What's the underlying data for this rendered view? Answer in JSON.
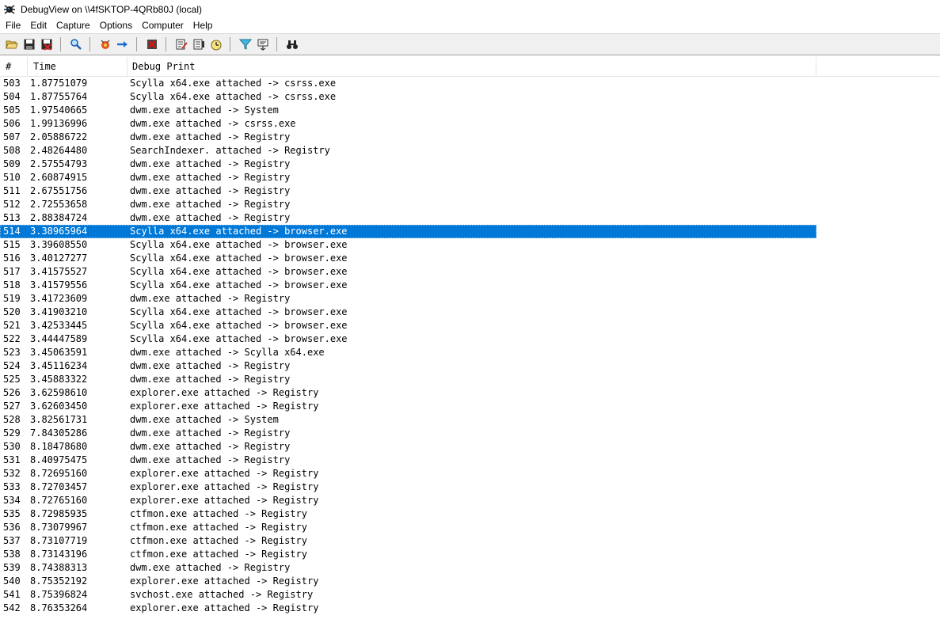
{
  "window": {
    "title": "DebugView on \\\\4fSKTOP-4QRb80J (local)"
  },
  "menu": [
    "File",
    "Edit",
    "Capture",
    "Options",
    "Computer",
    "Help"
  ],
  "toolbar": {
    "groups": [
      [
        "open-icon",
        "save-icon",
        "clear-log-icon"
      ],
      [
        "find-icon"
      ],
      [
        "capture-icon",
        "autoscroll-icon"
      ],
      [
        "stop-capture-icon"
      ],
      [
        "edit-filter-icon",
        "highlight-icon",
        "clock-icon"
      ],
      [
        "filter-icon",
        "history-icon"
      ],
      [
        "binoculars-icon"
      ]
    ]
  },
  "columns": {
    "num": "#",
    "time": "Time",
    "print": "Debug Print"
  },
  "colors": {
    "selection": "#0078d7"
  },
  "selected_row": "514",
  "rows": [
    [
      "503",
      "1.87751079",
      "Scylla x64.exe attached -> csrss.exe"
    ],
    [
      "504",
      "1.87755764",
      "Scylla x64.exe attached -> csrss.exe"
    ],
    [
      "505",
      "1.97540665",
      "dwm.exe attached -> System"
    ],
    [
      "506",
      "1.99136996",
      "dwm.exe attached -> csrss.exe"
    ],
    [
      "507",
      "2.05886722",
      "dwm.exe attached -> Registry"
    ],
    [
      "508",
      "2.48264480",
      "SearchIndexer. attached -> Registry"
    ],
    [
      "509",
      "2.57554793",
      "dwm.exe attached -> Registry"
    ],
    [
      "510",
      "2.60874915",
      "dwm.exe attached -> Registry"
    ],
    [
      "511",
      "2.67551756",
      "dwm.exe attached -> Registry"
    ],
    [
      "512",
      "2.72553658",
      "dwm.exe attached -> Registry"
    ],
    [
      "513",
      "2.88384724",
      "dwm.exe attached -> Registry"
    ],
    [
      "514",
      "3.38965964",
      "Scylla x64.exe attached -> browser.exe"
    ],
    [
      "515",
      "3.39608550",
      "Scylla x64.exe attached -> browser.exe"
    ],
    [
      "516",
      "3.40127277",
      "Scylla x64.exe attached -> browser.exe"
    ],
    [
      "517",
      "3.41575527",
      "Scylla x64.exe attached -> browser.exe"
    ],
    [
      "518",
      "3.41579556",
      "Scylla x64.exe attached -> browser.exe"
    ],
    [
      "519",
      "3.41723609",
      "dwm.exe attached -> Registry"
    ],
    [
      "520",
      "3.41903210",
      "Scylla x64.exe attached -> browser.exe"
    ],
    [
      "521",
      "3.42533445",
      "Scylla x64.exe attached -> browser.exe"
    ],
    [
      "522",
      "3.44447589",
      "Scylla x64.exe attached -> browser.exe"
    ],
    [
      "523",
      "3.45063591",
      "dwm.exe attached -> Scylla x64.exe"
    ],
    [
      "524",
      "3.45116234",
      "dwm.exe attached -> Registry"
    ],
    [
      "525",
      "3.45883322",
      "dwm.exe attached -> Registry"
    ],
    [
      "526",
      "3.62598610",
      "explorer.exe attached -> Registry"
    ],
    [
      "527",
      "3.62603450",
      "explorer.exe attached -> Registry"
    ],
    [
      "528",
      "3.82561731",
      "dwm.exe attached -> System"
    ],
    [
      "529",
      "7.84305286",
      "dwm.exe attached -> Registry"
    ],
    [
      "530",
      "8.18478680",
      "dwm.exe attached -> Registry"
    ],
    [
      "531",
      "8.40975475",
      "dwm.exe attached -> Registry"
    ],
    [
      "532",
      "8.72695160",
      "explorer.exe attached -> Registry"
    ],
    [
      "533",
      "8.72703457",
      "explorer.exe attached -> Registry"
    ],
    [
      "534",
      "8.72765160",
      "explorer.exe attached -> Registry"
    ],
    [
      "535",
      "8.72985935",
      "ctfmon.exe attached -> Registry"
    ],
    [
      "536",
      "8.73079967",
      "ctfmon.exe attached -> Registry"
    ],
    [
      "537",
      "8.73107719",
      "ctfmon.exe attached -> Registry"
    ],
    [
      "538",
      "8.73143196",
      "ctfmon.exe attached -> Registry"
    ],
    [
      "539",
      "8.74388313",
      "dwm.exe attached -> Registry"
    ],
    [
      "540",
      "8.75352192",
      "explorer.exe attached -> Registry"
    ],
    [
      "541",
      "8.75396824",
      "svchost.exe attached -> Registry"
    ],
    [
      "542",
      "8.76353264",
      "explorer.exe attached -> Registry"
    ]
  ]
}
